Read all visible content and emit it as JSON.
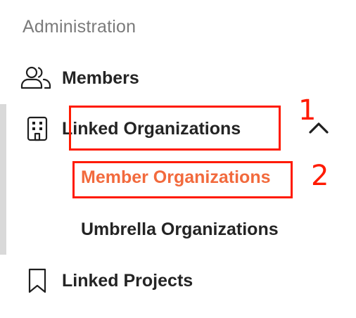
{
  "section": {
    "title": "Administration"
  },
  "nav": {
    "members": {
      "label": "Members",
      "icon": "people-icon"
    },
    "linked_organizations": {
      "label": "Linked Organizations",
      "icon": "building-icon",
      "expanded": true,
      "children": [
        {
          "label": "Member Organizations",
          "active": true
        },
        {
          "label": "Umbrella Organizations",
          "active": false
        }
      ]
    },
    "linked_projects": {
      "label": "Linked Projects",
      "icon": "bookmark-icon"
    }
  },
  "annotations": {
    "box1_number": "1",
    "box2_number": "2"
  },
  "colors": {
    "active": "#f26a3d",
    "annotation": "#ff1a00",
    "text": "#242424",
    "muted": "#7b7b7b"
  }
}
